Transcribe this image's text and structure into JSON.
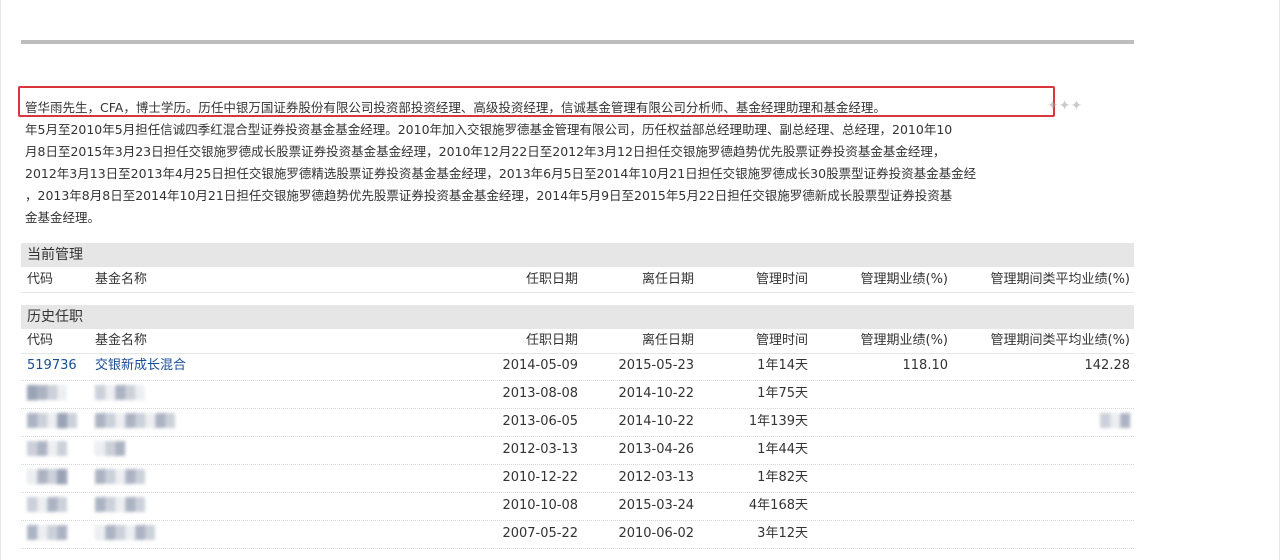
{
  "bio": {
    "lines": [
      "管华雨先生，CFA，博士学历。历任中银万国证券股份有限公司投资部投资经理、高级投资经理，信诚基金管理有限公司分析师、基金经理助理和基金经理。",
      "年5月至2010年5月担任信诚四季红混合型证券投资基金基金经理。2010年加入交银施罗德基金管理有限公司，历任权益部总经理助理、副总经理、总经理，2010年10",
      "月8日至2015年3月23日担任交银施罗德成长股票证券投资基金基金经理，2010年12月22日至2012年3月12日担任交银施罗德趋势优先股票证券投资基金基金经理，",
      "2012年3月13日至2013年4月25日担任交银施罗德精选股票证券投资基金基金经理，2013年6月5日至2014年10月21日担任交银施罗德成长30股票型证券投资基金基金经",
      "，2013年8月8日至2014年10月21日担任交银施罗德趋势优先股票证券投资基金基金经理，2014年5月9日至2015年5月22日担任交银施罗德新成长股票型证券投资基",
      "金基金经理。"
    ]
  },
  "current": {
    "title": "当前管理",
    "headers": {
      "code": "代码",
      "name": "基金名称",
      "start": "任职日期",
      "end": "离任日期",
      "duration": "管理时间",
      "perf": "管理期业绩(%)",
      "avg": "管理期间类平均业绩(%)"
    }
  },
  "history": {
    "title": "历史任职",
    "headers": {
      "code": "代码",
      "name": "基金名称",
      "start": "任职日期",
      "end": "离任日期",
      "duration": "管理时间",
      "perf": "管理期业绩(%)",
      "avg": "管理期间类平均业绩(%)"
    },
    "rows": [
      {
        "code": "519736",
        "name": "交银新成长混合",
        "start": "2014-05-09",
        "end": "2015-05-23",
        "duration": "1年14天",
        "perf": "118.10",
        "avg": "142.28"
      },
      {
        "code": "",
        "name": "",
        "start": "2013-08-08",
        "end": "2014-10-22",
        "duration": "1年75天",
        "perf": "",
        "avg": ""
      },
      {
        "code": "",
        "name": "",
        "start": "2013-06-05",
        "end": "2014-10-22",
        "duration": "1年139天",
        "perf": "",
        "avg": ""
      },
      {
        "code": "",
        "name": "",
        "start": "2012-03-13",
        "end": "2013-04-26",
        "duration": "1年44天",
        "perf": "",
        "avg": ""
      },
      {
        "code": "",
        "name": "",
        "start": "2010-12-22",
        "end": "2012-03-13",
        "duration": "1年82天",
        "perf": "",
        "avg": ""
      },
      {
        "code": "",
        "name": "",
        "start": "2010-10-08",
        "end": "2015-03-24",
        "duration": "4年168天",
        "perf": "",
        "avg": ""
      },
      {
        "code": "",
        "name": "",
        "start": "2007-05-22",
        "end": "2010-06-02",
        "duration": "3年12天",
        "perf": "",
        "avg": ""
      }
    ]
  },
  "colors": {
    "highlight_border": "#d9363e",
    "link": "#1a4d99",
    "section_bg": "#e6e6e6"
  }
}
